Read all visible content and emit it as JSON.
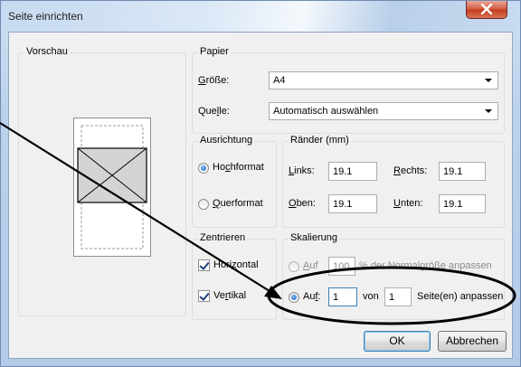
{
  "window": {
    "title": "Seite einrichten",
    "close_icon": "close-x-icon"
  },
  "preview": {
    "legend": "Vorschau"
  },
  "paper": {
    "legend": "Papier",
    "size_label_u": "G",
    "size_label_rest": "röße:",
    "size_value": "A4",
    "source_label_pre": "Que",
    "source_label_u": "l",
    "source_label_rest": "le:",
    "source_value": "Automatisch auswählen"
  },
  "orientation": {
    "legend": "Ausrichtung",
    "portrait_pre": "Ho",
    "portrait_u": "c",
    "portrait_rest": "hformat",
    "landscape_u": "Q",
    "landscape_rest": "uerformat",
    "selected": "portrait"
  },
  "margins": {
    "legend": "Ränder (mm)",
    "left_u": "L",
    "left_rest": "inks:",
    "left_value": "19.1",
    "right_u": "R",
    "right_rest": "echts:",
    "right_value": "19.1",
    "top_u": "O",
    "top_rest": "ben:",
    "top_value": "19.1",
    "bottom_u": "U",
    "bottom_rest": "nten:",
    "bottom_value": "19.1"
  },
  "centering": {
    "legend": "Zentrieren",
    "horizontal_pre": "Hori",
    "horizontal_u": "z",
    "horizontal_rest": "ontal",
    "horizontal_checked": true,
    "vertical_pre": "Ve",
    "vertical_u": "r",
    "vertical_rest": "tikal",
    "vertical_checked": true
  },
  "scaling": {
    "legend": "Skalierung",
    "adjust_u": "A",
    "adjust_rest": "uf",
    "adjust_value": "100",
    "adjust_suffix": "% der Normalgröße anpassen",
    "fit_pre": "Au",
    "fit_u": "f",
    "fit_rest": ":",
    "fit_pages_wide": "1",
    "fit_von": "von",
    "fit_pages_tall": "1",
    "fit_suffix": "Seite(en) anpassen",
    "selected": "fit"
  },
  "buttons": {
    "ok": "OK",
    "cancel": "Abbrechen"
  },
  "annotation": {
    "colors": {
      "ink": "#000000"
    }
  }
}
